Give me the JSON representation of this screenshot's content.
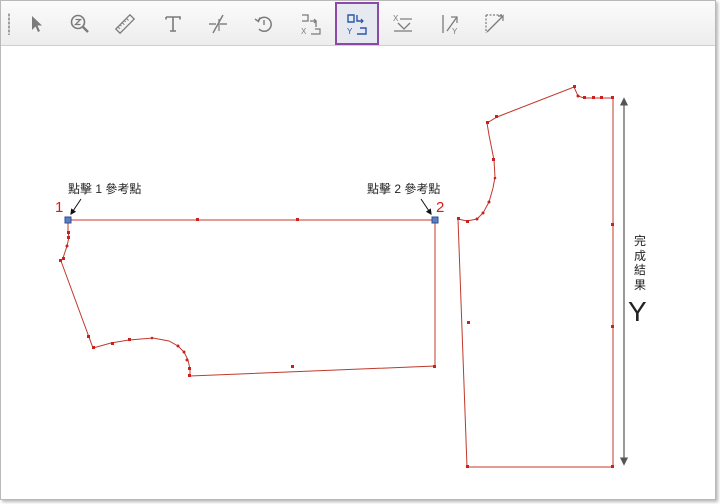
{
  "toolbar": {
    "tools": [
      {
        "name": "select",
        "icon": "arrow-cursor-icon",
        "active": false
      },
      {
        "name": "zoom",
        "icon": "magnifier-icon",
        "active": false
      },
      {
        "name": "measure",
        "icon": "ruler-icon",
        "active": false
      },
      {
        "name": "text",
        "icon": "text-t-icon",
        "active": false
      },
      {
        "name": "cut",
        "icon": "slash-lines-icon",
        "active": false
      },
      {
        "name": "rotate",
        "icon": "rotate-icon",
        "active": false
      },
      {
        "name": "align-x",
        "icon": "align-x-icon",
        "active": false
      },
      {
        "name": "align-y",
        "icon": "align-y-icon",
        "active": true
      },
      {
        "name": "mirror-x",
        "icon": "mirror-x-icon",
        "active": false
      },
      {
        "name": "mirror-y",
        "icon": "mirror-y-icon",
        "active": false
      },
      {
        "name": "diagonal",
        "icon": "diagonal-icon",
        "active": false
      }
    ]
  },
  "annotations": {
    "ref1_label": "點擊 1 參考點",
    "ref2_label": "點擊 2 參考點",
    "ref1_number": "1",
    "ref2_number": "2",
    "result_label": "完成結果",
    "result_axis": "Y"
  },
  "colors": {
    "outline": "#c0392b",
    "point": "#cc1f1f",
    "active_tool_border": "#8b4aa5",
    "number": "#e11616"
  }
}
